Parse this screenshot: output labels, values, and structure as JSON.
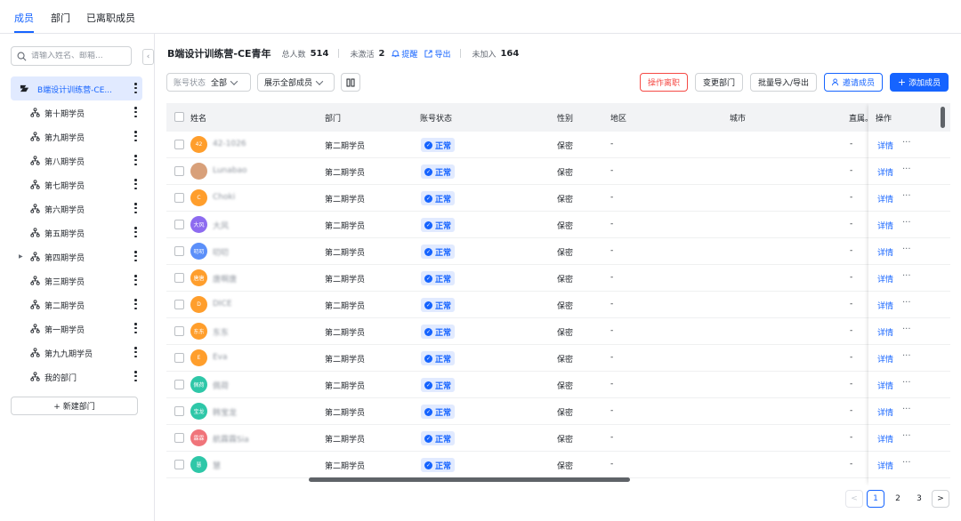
{
  "top_tabs": [
    {
      "label": "成员",
      "active": true
    },
    {
      "label": "部门",
      "active": false
    },
    {
      "label": "已离职成员",
      "active": false
    }
  ],
  "sidebar": {
    "search_placeholder": "请输入姓名、邮箱...",
    "root": {
      "label": "B端设计训练营-CE..."
    },
    "items": [
      {
        "label": "第十期学员"
      },
      {
        "label": "第九期学员"
      },
      {
        "label": "第八期学员"
      },
      {
        "label": "第七期学员"
      },
      {
        "label": "第六期学员"
      },
      {
        "label": "第五期学员"
      },
      {
        "label": "第四期学员",
        "has_children": true
      },
      {
        "label": "第三期学员"
      },
      {
        "label": "第二期学员"
      },
      {
        "label": "第一期学员"
      },
      {
        "label": "第九九期学员"
      },
      {
        "label": "我的部门"
      }
    ],
    "new_dept_label": "+ 新建部门"
  },
  "header": {
    "title": "B端设计训练营-CE青年",
    "total_label": "总人数",
    "total_value": "514",
    "inactive_label": "未激活",
    "inactive_value": "2",
    "remind_label": "提醒",
    "export_label": "导出",
    "not_joined_label": "未加入",
    "not_joined_value": "164"
  },
  "toolbar": {
    "status_filter": {
      "key": "账号状态",
      "value": "全部"
    },
    "member_filter": "展示全部成员",
    "resign_label": "操作离职",
    "change_dept_label": "变更部门",
    "import_export_label": "批量导入/导出",
    "invite_label": "邀请成员",
    "add_label": "添加成员"
  },
  "table": {
    "columns": [
      "姓名",
      "部门",
      "账号状态",
      "性别",
      "地区",
      "城市",
      "直属。",
      "操作"
    ],
    "status_text": "正常",
    "detail_label": "详情",
    "more_label": "···",
    "rows": [
      {
        "name": "42-1026",
        "avatar_text": "42",
        "avatar_color": "#ff9e2c",
        "dept": "第二期学员",
        "gender": "保密",
        "region": "-",
        "city": "",
        "manager": "-"
      },
      {
        "name": "Lunabao",
        "avatar_text": "",
        "avatar_color": "#d8a07a",
        "dept": "第二期学员",
        "gender": "保密",
        "region": "-",
        "city": "",
        "manager": "-"
      },
      {
        "name": "Choki",
        "avatar_text": "C",
        "avatar_color": "#ff9e2c",
        "dept": "第二期学员",
        "gender": "保密",
        "region": "-",
        "city": "",
        "manager": "-"
      },
      {
        "name": "大风",
        "avatar_text": "大风",
        "avatar_color": "#8d6bf0",
        "dept": "第二期学员",
        "gender": "保密",
        "region": "-",
        "city": "",
        "manager": "-"
      },
      {
        "name": "叨叨",
        "avatar_text": "叨叨",
        "avatar_color": "#5b8ff9",
        "dept": "第二期学员",
        "gender": "保密",
        "region": "-",
        "city": "",
        "manager": "-"
      },
      {
        "name": "唐啊唐",
        "avatar_text": "唐唐",
        "avatar_color": "#ff9e2c",
        "dept": "第二期学员",
        "gender": "保密",
        "region": "-",
        "city": "",
        "manager": "-"
      },
      {
        "name": "DICE",
        "avatar_text": "D",
        "avatar_color": "#ff9e2c",
        "dept": "第二期学员",
        "gender": "保密",
        "region": "-",
        "city": "",
        "manager": "-"
      },
      {
        "name": "东东",
        "avatar_text": "东东",
        "avatar_color": "#ff9e2c",
        "dept": "第二期学员",
        "gender": "保密",
        "region": "-",
        "city": "",
        "manager": "-"
      },
      {
        "name": "Eva",
        "avatar_text": "E",
        "avatar_color": "#ff9e2c",
        "dept": "第二期学员",
        "gender": "保密",
        "region": "-",
        "city": "",
        "manager": "-"
      },
      {
        "name": "佩荷",
        "avatar_text": "佩荷",
        "avatar_color": "#2ec7a8",
        "dept": "第二期学员",
        "gender": "保密",
        "region": "-",
        "city": "",
        "manager": "-"
      },
      {
        "name": "韩宝龙",
        "avatar_text": "宝龙",
        "avatar_color": "#2ec7a8",
        "dept": "第二期学员",
        "gender": "保密",
        "region": "-",
        "city": "",
        "manager": "-"
      },
      {
        "name": "航霖霖Sia",
        "avatar_text": "霖霖",
        "avatar_color": "#f0747a",
        "dept": "第二期学员",
        "gender": "保密",
        "region": "-",
        "city": "",
        "manager": "-"
      },
      {
        "name": "慧",
        "avatar_text": "慧",
        "avatar_color": "#2ec7a8",
        "dept": "第二期学员",
        "gender": "保密",
        "region": "-",
        "city": "",
        "manager": "-"
      }
    ]
  },
  "pagination": {
    "prev": "<",
    "pages": [
      "1",
      "2",
      "3"
    ],
    "current": "1",
    "next": ">"
  },
  "colors": {
    "accent": "#1664ff",
    "danger": "#f54a45",
    "status_bg": "#e1eaff"
  }
}
